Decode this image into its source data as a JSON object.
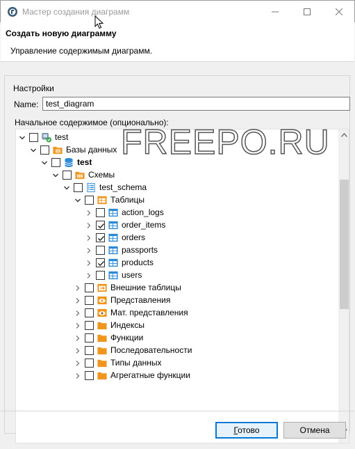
{
  "window": {
    "title": "Мастер создания диаграмм"
  },
  "header": {
    "title": "Создать новую диаграмму",
    "description": "Управление содержимым диаграмм."
  },
  "settings": {
    "group_label": "Настройки",
    "name_label": "Name:",
    "name_value": "test_diagram",
    "content_label": "Начальное содержимое (опционально):"
  },
  "tree": {
    "items": [
      {
        "label": "test",
        "level": 0,
        "expanded": true,
        "checked": false,
        "icon": "connection-icon",
        "bold": false
      },
      {
        "label": "Базы данных",
        "level": 1,
        "expanded": true,
        "checked": false,
        "icon": "folder-databases-icon",
        "bold": false
      },
      {
        "label": "test",
        "level": 2,
        "expanded": true,
        "checked": false,
        "icon": "database-icon",
        "bold": true
      },
      {
        "label": "Схемы",
        "level": 3,
        "expanded": true,
        "checked": false,
        "icon": "schemas-icon",
        "bold": false
      },
      {
        "label": "test_schema",
        "level": 4,
        "expanded": true,
        "checked": false,
        "icon": "schema-icon",
        "bold": false
      },
      {
        "label": "Таблицы",
        "level": 5,
        "expanded": true,
        "checked": false,
        "icon": "tables-folder-icon",
        "bold": false
      },
      {
        "label": "action_logs",
        "level": 6,
        "expanded": false,
        "checked": false,
        "icon": "table-icon",
        "bold": false
      },
      {
        "label": "order_items",
        "level": 6,
        "expanded": false,
        "checked": true,
        "icon": "table-icon",
        "bold": false
      },
      {
        "label": "orders",
        "level": 6,
        "expanded": false,
        "checked": true,
        "icon": "table-icon",
        "bold": false
      },
      {
        "label": "passports",
        "level": 6,
        "expanded": false,
        "checked": false,
        "icon": "table-icon",
        "bold": false
      },
      {
        "label": "products",
        "level": 6,
        "expanded": false,
        "checked": true,
        "icon": "table-icon",
        "bold": false
      },
      {
        "label": "users",
        "level": 6,
        "expanded": false,
        "checked": false,
        "icon": "table-icon",
        "bold": false
      },
      {
        "label": "Внешние таблицы",
        "level": 5,
        "expanded": false,
        "checked": false,
        "icon": "foreign-tables-icon",
        "bold": false
      },
      {
        "label": "Представления",
        "level": 5,
        "expanded": false,
        "checked": false,
        "icon": "views-icon",
        "bold": false
      },
      {
        "label": "Мат. представления",
        "level": 5,
        "expanded": false,
        "checked": false,
        "icon": "mat-views-icon",
        "bold": false
      },
      {
        "label": "Индексы",
        "level": 5,
        "expanded": false,
        "checked": false,
        "icon": "folder-icon",
        "bold": false
      },
      {
        "label": "Функции",
        "level": 5,
        "expanded": false,
        "checked": false,
        "icon": "folder-icon",
        "bold": false
      },
      {
        "label": "Последовательности",
        "level": 5,
        "expanded": false,
        "checked": false,
        "icon": "folder-icon",
        "bold": false
      },
      {
        "label": "Типы данных",
        "level": 5,
        "expanded": false,
        "checked": false,
        "icon": "folder-icon",
        "bold": false
      },
      {
        "label": "Агрегатные функции",
        "level": 5,
        "expanded": false,
        "checked": false,
        "icon": "folder-icon",
        "bold": false
      }
    ]
  },
  "buttons": {
    "ok_label": "Готово",
    "cancel_label": "Отмена"
  },
  "watermark": "FREEPO.RU",
  "colors": {
    "accent": "#0078d7",
    "folder": "#f0961e",
    "table": "#2b8ad8"
  }
}
